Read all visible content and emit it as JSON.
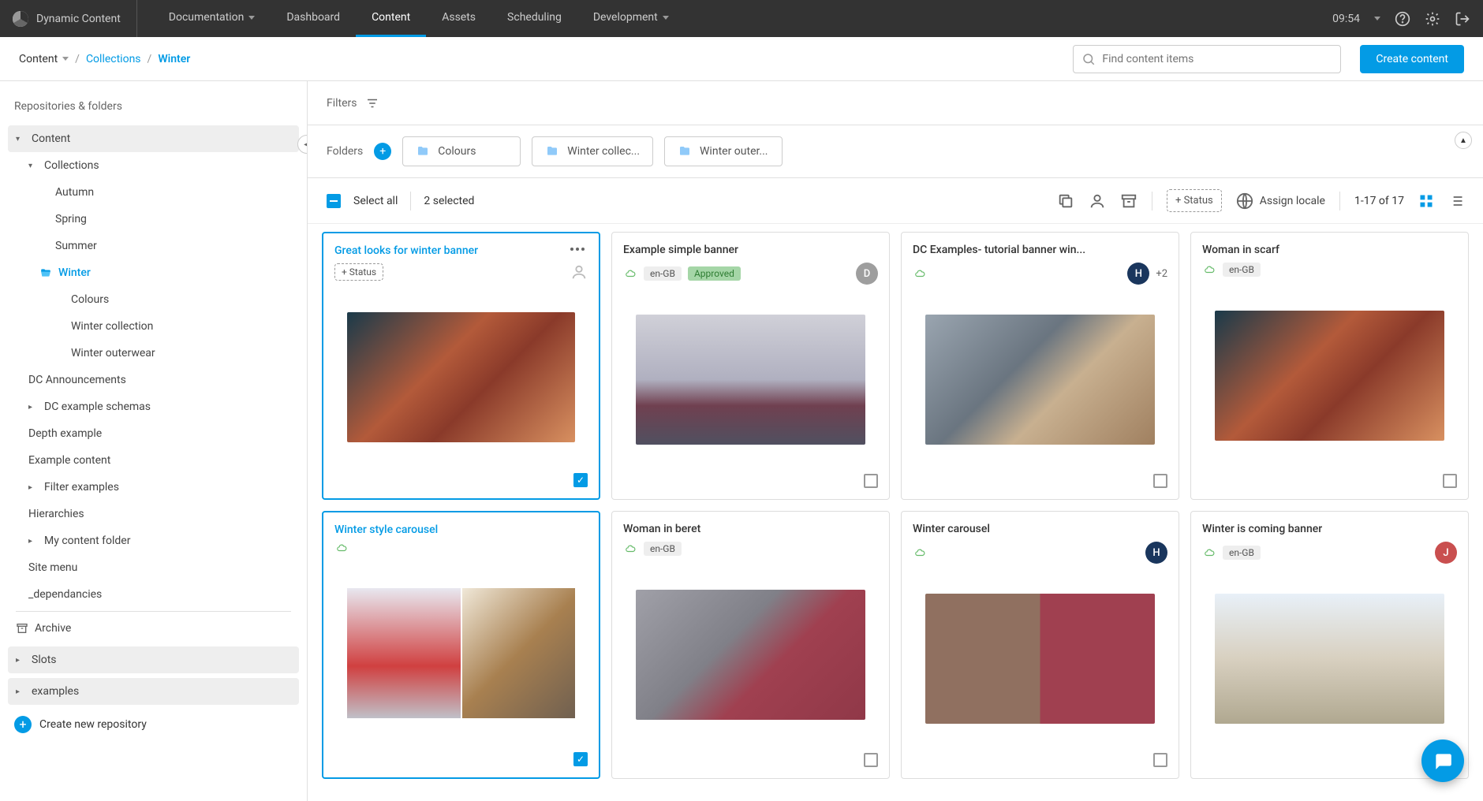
{
  "topbar": {
    "brand": "Dynamic Content",
    "nav": {
      "documentation": "Documentation",
      "dashboard": "Dashboard",
      "content": "Content",
      "assets": "Assets",
      "scheduling": "Scheduling",
      "development": "Development"
    },
    "time": "09:54"
  },
  "breadcrumb": {
    "root": "Content",
    "collections": "Collections",
    "current": "Winter"
  },
  "search_placeholder": "Find content items",
  "create_button": "Create content",
  "sidebar": {
    "title": "Repositories & folders",
    "repo": "Content",
    "collections": "Collections",
    "seasons": {
      "autumn": "Autumn",
      "spring": "Spring",
      "summer": "Summer",
      "winter": "Winter"
    },
    "winter_children": {
      "colours": "Colours",
      "collection": "Winter collection",
      "outerwear": "Winter outerwear"
    },
    "others": {
      "dc_announcements": "DC Announcements",
      "dc_example_schemas": "DC example schemas",
      "depth_example": "Depth example",
      "example_content": "Example content",
      "filter_examples": "Filter examples",
      "hierarchies": "Hierarchies",
      "my_content_folder": "My content folder",
      "site_menu": "Site menu",
      "dependancies": "_dependancies"
    },
    "archive": "Archive",
    "slots": "Slots",
    "examples": "examples",
    "create_repo": "Create new repository"
  },
  "filters_label": "Filters",
  "folders_label": "Folders",
  "folder_chips": {
    "colours": "Colours",
    "collection": "Winter collec...",
    "outerwear": "Winter outer..."
  },
  "selection": {
    "select_all": "Select all",
    "count": "2 selected"
  },
  "toolbar": {
    "add_status": "+ Status",
    "assign_locale": "Assign locale",
    "pagination": "1-17 of 17"
  },
  "cards": [
    {
      "title": "Great looks for winter banner",
      "add_status": "+ Status",
      "selected": true
    },
    {
      "title": "Example simple banner",
      "locale": "en-GB",
      "status": "Approved",
      "avatar": "D",
      "avatar_bg": "#9e9e9e"
    },
    {
      "title": "DC Examples- tutorial banner win...",
      "avatar": "H",
      "avatar_bg": "#1a365d",
      "extra": "+2"
    },
    {
      "title": "Woman in scarf",
      "locale": "en-GB"
    },
    {
      "title": "Winter style carousel",
      "selected": true
    },
    {
      "title": "Woman in beret",
      "locale": "en-GB"
    },
    {
      "title": "Winter carousel",
      "avatar": "H",
      "avatar_bg": "#1a365d"
    },
    {
      "title": "Winter is coming banner",
      "locale": "en-GB",
      "avatar": "J",
      "avatar_bg": "#c94f4f"
    }
  ]
}
